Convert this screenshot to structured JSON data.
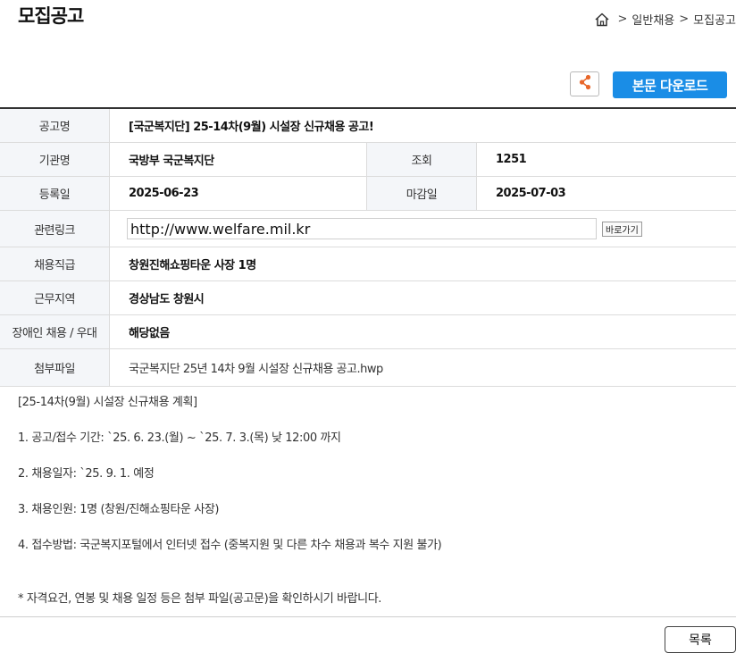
{
  "page": {
    "title": "모집공고"
  },
  "breadcrumb": {
    "home_icon": "home-icon",
    "separator": ">",
    "items": [
      "일반채용",
      "모집공고"
    ]
  },
  "actions": {
    "share_icon": "share-icon",
    "download_label": "본문 다운로드",
    "download_color": "#1a8de6"
  },
  "details": {
    "announcement_label": "공고명",
    "announcement_value": "[국군복지단] 25-14차(9월) 시설장 신규채용 공고!",
    "agency_label": "기관명",
    "agency_value": "국방부 국군복지단",
    "views_label": "조회",
    "views_value": "1251",
    "registered_label": "등록일",
    "registered_value": "2025-06-23",
    "deadline_label": "마감일",
    "deadline_value": "2025-07-03",
    "link_label": "관련링크",
    "link_value": "http://www.welfare.mil.kr",
    "link_button": "바로가기",
    "position_label": "채용직급",
    "position_value": "창원진해쇼핑타운 사장 1명",
    "location_label": "근무지역",
    "location_value": "경상남도 창원시",
    "disability_label": "장애인 채용 / 우대",
    "disability_value": "해당없음",
    "attachment_label": "첨부파일",
    "attachment_value": "국군복지단 25년 14차 9월 시설장 신규채용 공고.hwp"
  },
  "body": {
    "heading": "[25-14차(9월) 시설장 신규채용 계획]",
    "item1": "1. 공고/접수 기간: `25. 6. 23.(월) ~ `25. 7. 3.(목) 낮 12:00 까지",
    "item2": "2. 채용일자: `25. 9. 1. 예정",
    "item3": "3. 채용인원: 1명 (창원/진해쇼핑타운 사장)",
    "item4": "4. 접수방법: 국군복지포털에서 인터넷 접수 (중복지원 및 다른 차수 채용과 복수 지원 불가)",
    "note": "* 자격요건, 연봉 및 채용 일정 등은 첨부 파일(공고문)을 확인하시기 바랍니다."
  },
  "footer": {
    "list_button": "목록"
  }
}
